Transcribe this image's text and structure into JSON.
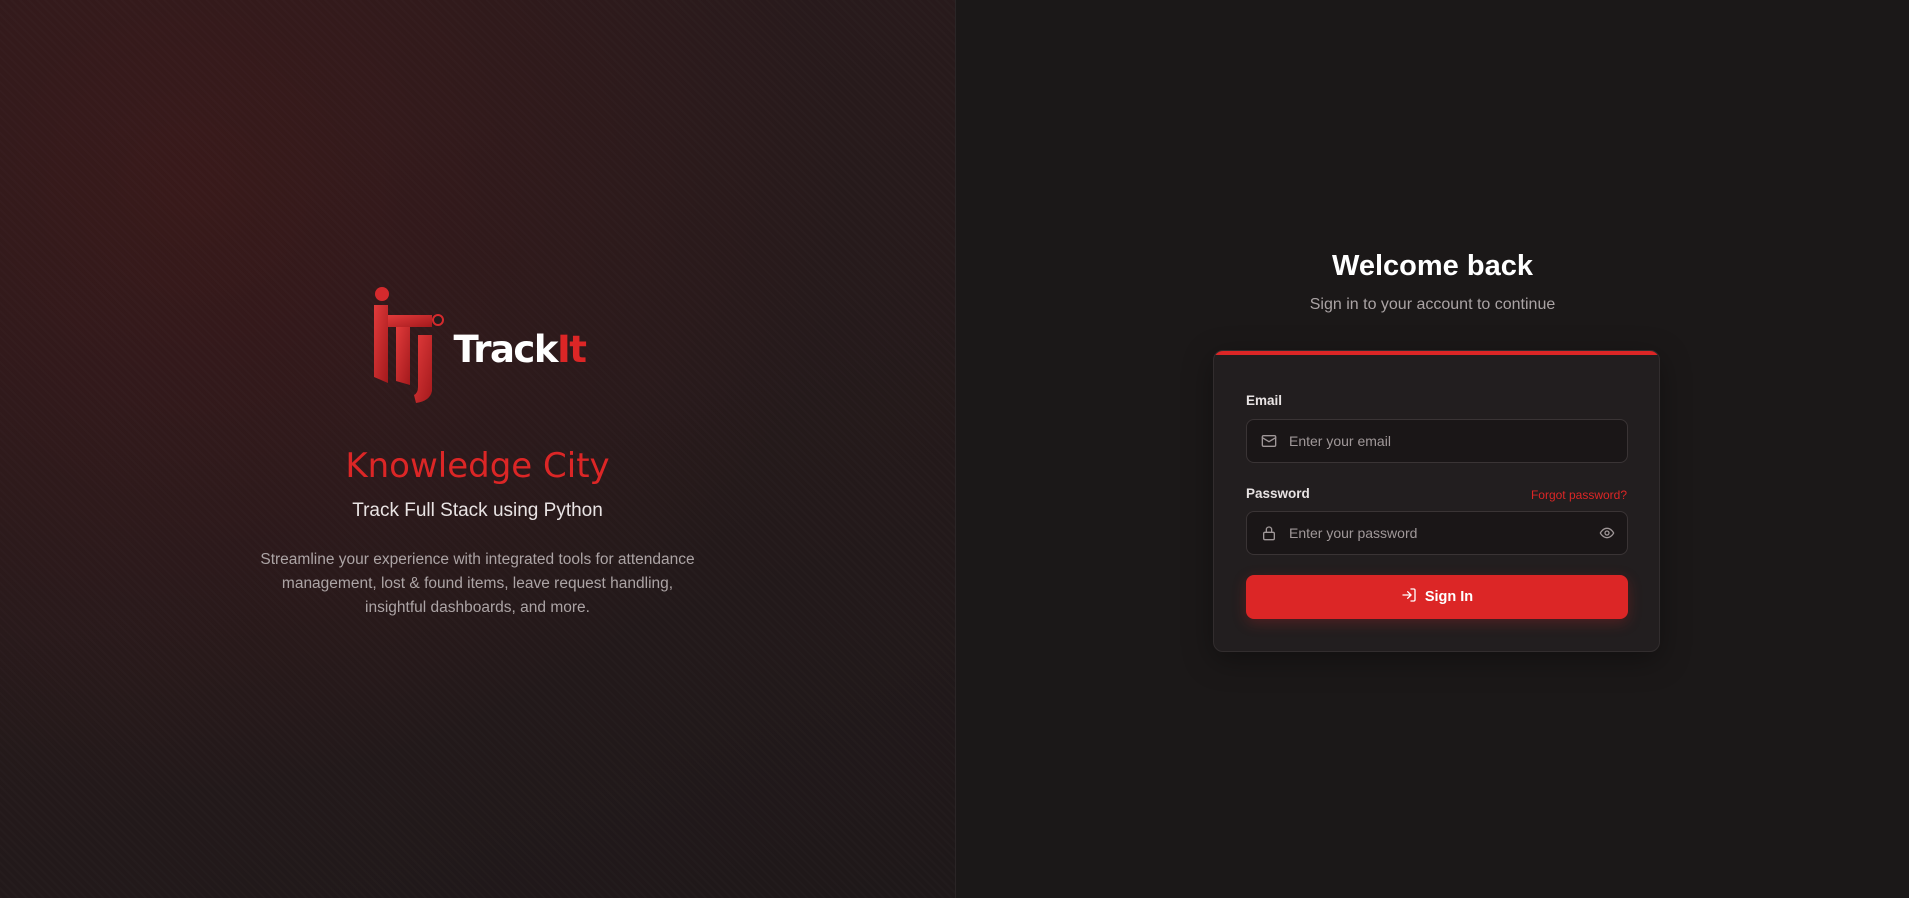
{
  "brand": {
    "logo_word_main": "Track",
    "logo_word_accent": "It",
    "logo_icon": "trackit-logo-mark",
    "accent_color": "#dc2626"
  },
  "hero": {
    "org_name": "Knowledge City",
    "subtitle": "Track Full Stack using Python",
    "description": "Streamline your experience with integrated tools for attendance management, lost & found items, leave request handling, insightful dashboards, and more."
  },
  "auth": {
    "title": "Welcome back",
    "subtitle": "Sign in to your account to continue",
    "email": {
      "label": "Email",
      "placeholder": "Enter your email",
      "value": "",
      "icon": "mail-icon"
    },
    "password": {
      "label": "Password",
      "placeholder": "Enter your password",
      "value": "",
      "icon": "lock-icon",
      "toggle_icon": "eye-icon"
    },
    "forgot_label": "Forgot password?",
    "submit_label": "Sign In",
    "submit_icon": "login-icon"
  }
}
